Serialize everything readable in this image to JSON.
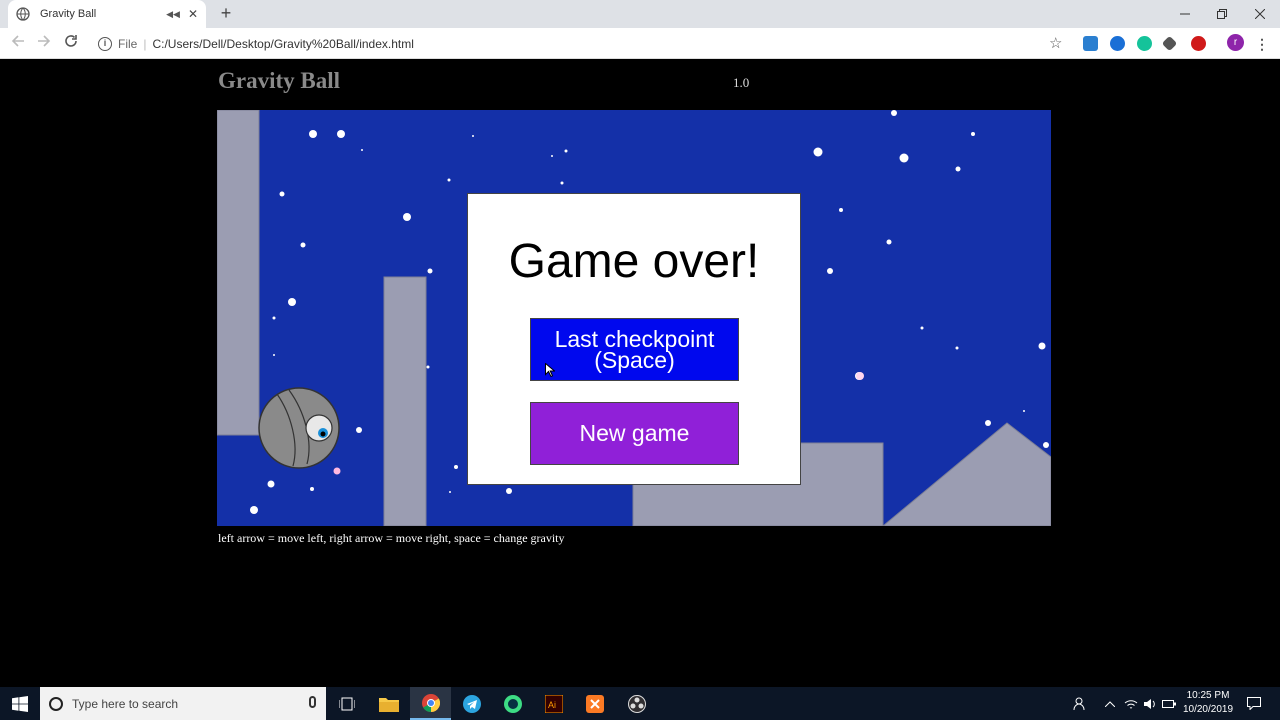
{
  "browser": {
    "tab_title": "Gravity Ball",
    "new_tab_symbol": "+",
    "url_scheme": "File",
    "url": "C:/Users/Dell/Desktop/Gravity%20Ball/index.html",
    "window_controls": [
      "minimize",
      "maximize",
      "close"
    ],
    "extensions": [
      {
        "name": "extension-1-icon",
        "color": "#2b7fd0"
      },
      {
        "name": "extension-2-icon",
        "color": "#1a6fd6"
      },
      {
        "name": "grammarly-icon",
        "color": "#15c39a"
      },
      {
        "name": "extension-4-icon",
        "color": "#555555"
      },
      {
        "name": "extension-5-icon",
        "color": "#d01a1a"
      },
      {
        "name": "profile-avatar",
        "color": "#8e24aa",
        "letter": "r"
      }
    ]
  },
  "page": {
    "title": "Gravity Ball",
    "version": "1.0",
    "instructions": "left arrow = move left, right arrow = move right, space = change gravity"
  },
  "game": {
    "background_color": "#1430a8",
    "wall_color": "#9b9db2",
    "dialog": {
      "heading": "Game over!",
      "checkpoint_button": "Last checkpoint (Space)",
      "checkpoint_color": "#0008ee",
      "new_game_button": "New game",
      "new_game_color": "#9020d8"
    }
  },
  "taskbar": {
    "search_placeholder": "Type here to search",
    "apps": [
      "task-view-icon",
      "file-explorer-icon",
      "chrome-icon",
      "telegram-icon",
      "android-studio-icon",
      "illustrator-icon",
      "xampp-icon",
      "obs-icon"
    ],
    "time": "10:25 PM",
    "date": "10/20/2019"
  }
}
